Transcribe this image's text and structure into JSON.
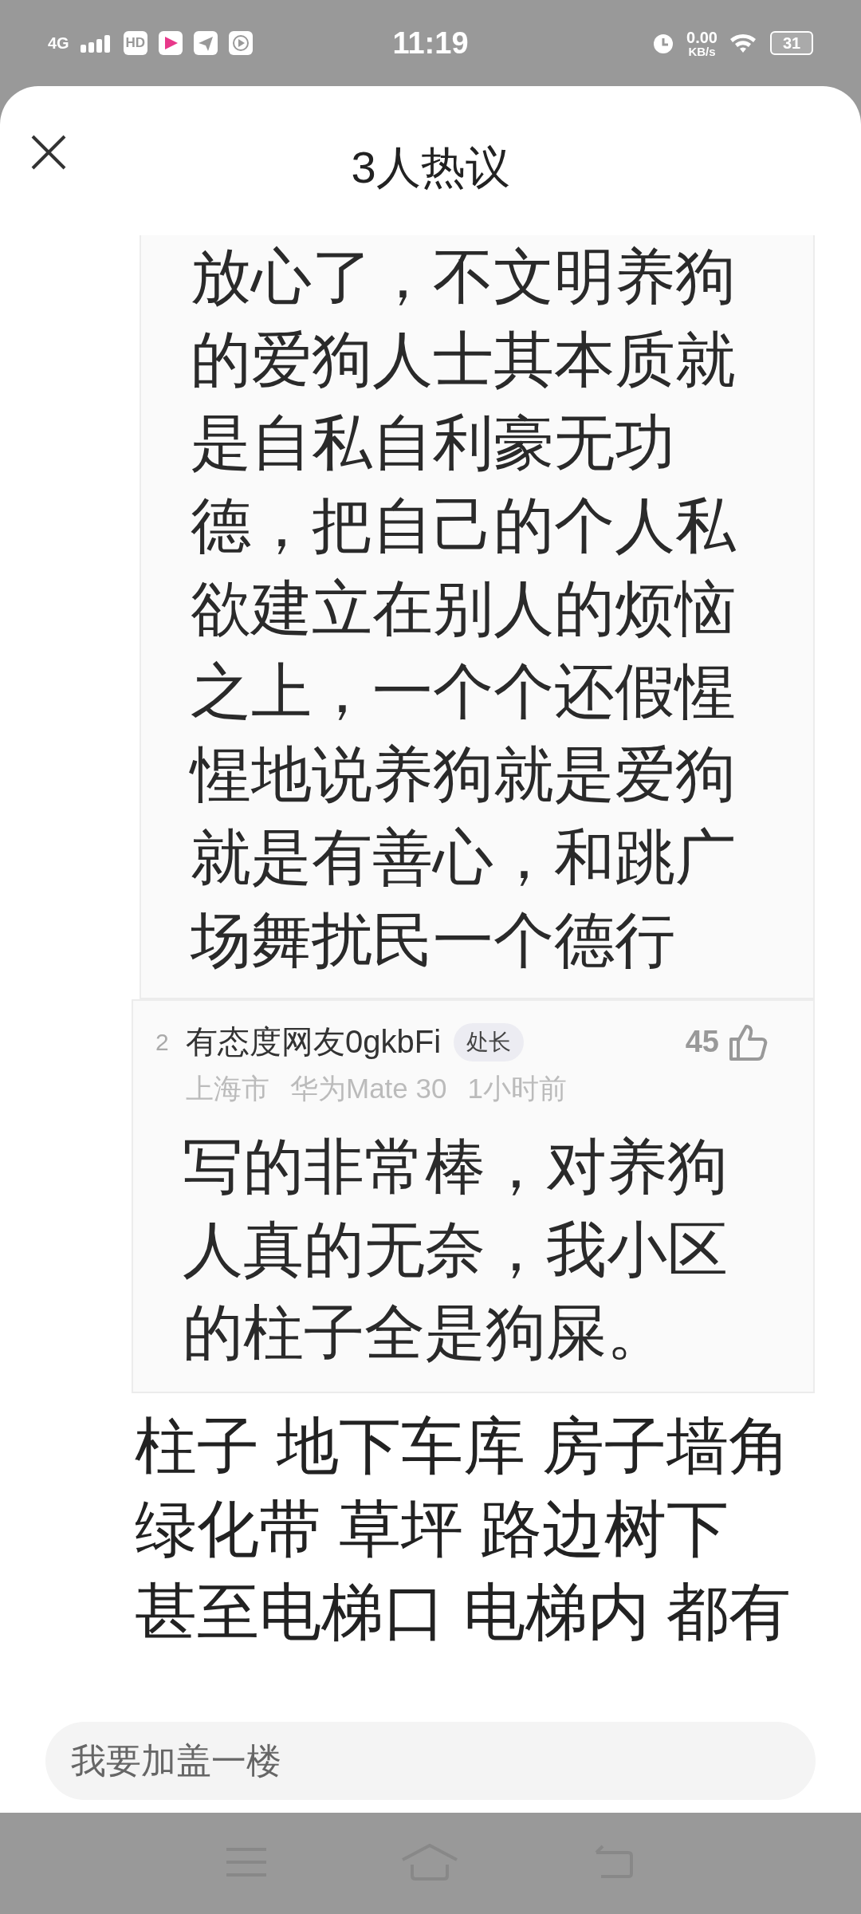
{
  "status_bar": {
    "network": "4G",
    "hd": "HD",
    "time": "11:19",
    "speed": "0.00",
    "speed_unit": "KB/s",
    "battery": "31"
  },
  "header": {
    "title": "3人热议"
  },
  "quoted_comments": [
    {
      "kind": "continued",
      "text": "放心了，不文明养狗的爱狗人士其本质就是自私自利豪无功德，把自己的个人私欲建立在别人的烦恼之上，一个个还假惺惺地说养狗就是爱狗就是有善心，和跳广场舞扰民一个德行"
    },
    {
      "kind": "full",
      "rank": "2",
      "author": "有态度网友0gkbFi",
      "badge": "处长",
      "likes": "45",
      "location": "上海市",
      "device": "华为Mate 30",
      "time": "1小时前",
      "text": "写的非常棒，对养狗人真的无奈，我小区的柱子全是狗屎。"
    }
  ],
  "comment_lines": [
    "柱子 地下车库 房子墙角",
    "绿化带 草坪 路边树下",
    "甚至电梯口 电梯内 都有"
  ],
  "reply_field": {
    "placeholder": "我要加盖一楼"
  }
}
